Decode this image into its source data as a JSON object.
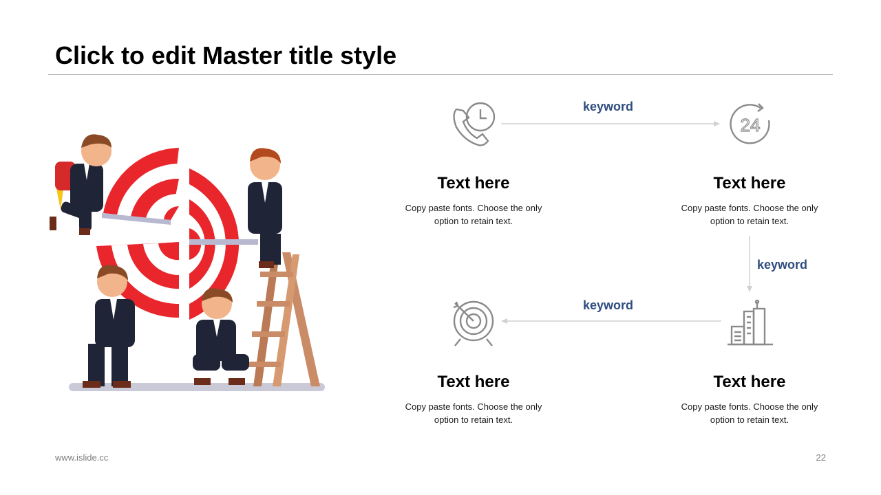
{
  "slide": {
    "title": "Click to edit Master title style",
    "footer_url": "www.islide.cc",
    "page_number": "22"
  },
  "keywords": {
    "top": "keyword",
    "right": "keyword",
    "bottom": "keyword"
  },
  "blocks": [
    {
      "icon": "phone-clock-icon",
      "heading": "Text here",
      "line1": "Copy paste fonts. Choose the only",
      "line2": "option to retain text."
    },
    {
      "icon": "clock-24-icon",
      "heading": "Text here",
      "line1": "Copy paste fonts. Choose the only",
      "line2": "option to retain text."
    },
    {
      "icon": "target-icon",
      "heading": "Text here",
      "line1": "Copy paste fonts. Choose the only",
      "line2": "option to retain text."
    },
    {
      "icon": "building-icon",
      "heading": "Text here",
      "line1": "Copy paste fonts. Choose the only",
      "line2": "option to retain text."
    }
  ],
  "colors": {
    "keyword": "#2f4d7e",
    "icon_stroke": "#8a8a8a",
    "arrow": "#d0d0d0",
    "target_red": "#e8262b",
    "suit": "#1f2436"
  }
}
